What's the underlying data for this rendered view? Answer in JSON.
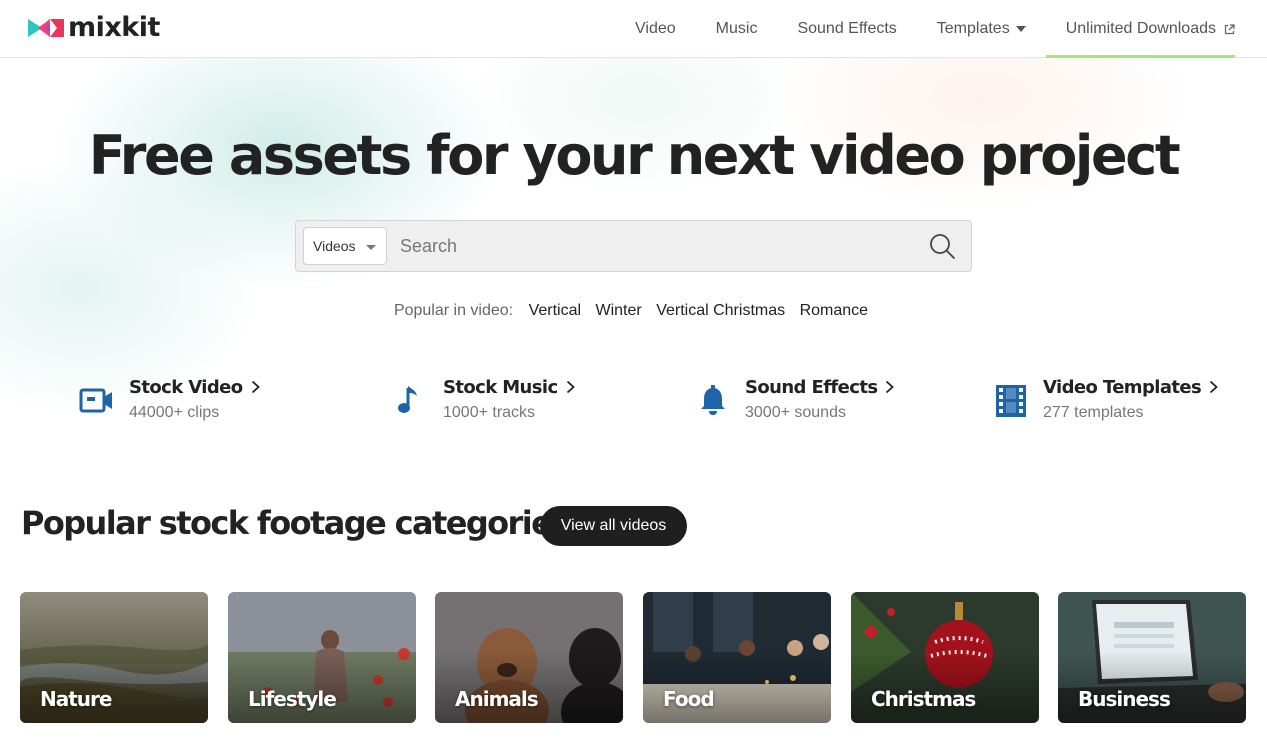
{
  "brand": {
    "name": "mixkit"
  },
  "nav": {
    "items": [
      {
        "label": "Video"
      },
      {
        "label": "Music"
      },
      {
        "label": "Sound Effects"
      },
      {
        "label": "Templates"
      },
      {
        "label": "Unlimited Downloads"
      }
    ],
    "accent_color": "#a6e86f"
  },
  "hero": {
    "title": "Free assets for your next video project",
    "search": {
      "type_selected": "Videos",
      "placeholder": "Search"
    },
    "popular": {
      "label": "Popular in video:",
      "tags": [
        "Vertical",
        "Winter",
        "Vertical Christmas",
        "Romance"
      ]
    }
  },
  "asset_categories": [
    {
      "title": "Stock Video",
      "count": "44000+ clips",
      "icon": "video-camera-icon"
    },
    {
      "title": "Stock Music",
      "count": "1000+ tracks",
      "icon": "music-note-icon"
    },
    {
      "title": "Sound Effects",
      "count": "3000+ sounds",
      "icon": "bell-icon"
    },
    {
      "title": "Video Templates",
      "count": "277 templates",
      "icon": "film-strip-icon"
    }
  ],
  "icon_color": "#1d64a8",
  "footage": {
    "title": "Popular stock footage categories",
    "view_all_label": "View all videos",
    "categories": [
      {
        "label": "Nature"
      },
      {
        "label": "Lifestyle"
      },
      {
        "label": "Animals"
      },
      {
        "label": "Food"
      },
      {
        "label": "Christmas"
      },
      {
        "label": "Business"
      }
    ]
  }
}
